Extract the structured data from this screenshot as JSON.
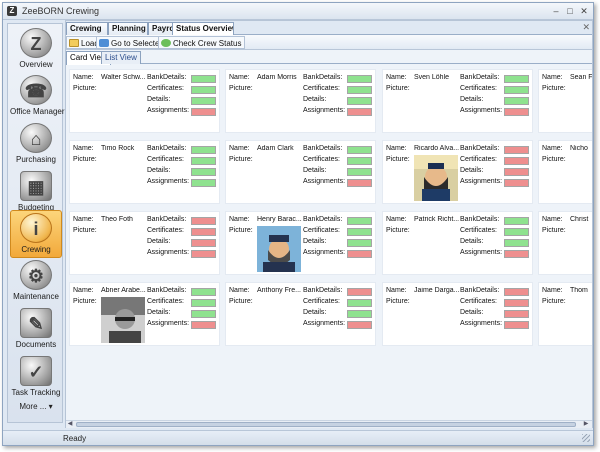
{
  "window": {
    "title": "ZeeBORN Crewing",
    "app_icon": "Z"
  },
  "sidebar": {
    "items": [
      {
        "label": "Overview",
        "icon": "Z",
        "icon_name": "zeeborn-logo-icon"
      },
      {
        "label": "Office Manager",
        "icon": "☎",
        "icon_name": "office-manager-icon"
      },
      {
        "label": "Purchasing",
        "icon": "⌂",
        "icon_name": "purchasing-icon"
      },
      {
        "label": "Budgeting",
        "icon": "▦",
        "icon_name": "budgeting-icon"
      },
      {
        "label": "Crewing",
        "icon": "i",
        "icon_name": "crewing-icon",
        "active": true
      },
      {
        "label": "Maintenance",
        "icon": "⚙",
        "icon_name": "maintenance-icon"
      },
      {
        "label": "Documents",
        "icon": "✎",
        "icon_name": "documents-icon"
      },
      {
        "label": "Task Tracking",
        "icon": "✓",
        "icon_name": "task-tracking-icon"
      }
    ],
    "more_label": "More ... ▾"
  },
  "doc_tabs": [
    {
      "label": "Crewing"
    },
    {
      "label": "Planning"
    },
    {
      "label": "Payro"
    },
    {
      "label": "Status Overview",
      "active": true
    }
  ],
  "toolbar": {
    "load": "Load",
    "goto": "Go to Selected",
    "check": "Check Crew Status"
  },
  "view_tabs": [
    {
      "label": "Card View",
      "active": true
    },
    {
      "label": "List View"
    }
  ],
  "card_labels": {
    "name": "Name:",
    "picture": "Picture:",
    "bank": "BankDetails:",
    "certs": "Certificates:",
    "details": "Details:",
    "assign": "Assignments:"
  },
  "cards": [
    {
      "name": "Walter Schw...",
      "status": [
        "ok",
        "ok",
        "ok",
        "bad"
      ],
      "photo": ""
    },
    {
      "name": "Adam Morris",
      "status": [
        "ok",
        "ok",
        "ok",
        "bad"
      ],
      "photo": ""
    },
    {
      "name": "Sven Löhle",
      "status": [
        "ok",
        "ok",
        "ok",
        "bad"
      ],
      "photo": ""
    },
    {
      "name": "Sean F",
      "status": [],
      "photo": ""
    },
    {
      "name": "Timo Rock",
      "status": [
        "ok",
        "ok",
        "ok",
        "ok"
      ],
      "photo": ""
    },
    {
      "name": "Adam Clark",
      "status": [
        "ok",
        "ok",
        "ok",
        "bad"
      ],
      "photo": ""
    },
    {
      "name": "Ricardo Alva...",
      "status": [
        "bad",
        "bad",
        "bad",
        "bad"
      ],
      "photo": "haddock"
    },
    {
      "name": "Nicho",
      "status": [],
      "photo": ""
    },
    {
      "name": "Theo Foth",
      "status": [
        "bad",
        "bad",
        "bad",
        "bad"
      ],
      "photo": ""
    },
    {
      "name": "Henry Barac...",
      "status": [
        "ok",
        "ok",
        "ok",
        "bad"
      ],
      "photo": "captain"
    },
    {
      "name": "Patrick Richt...",
      "status": [
        "ok",
        "ok",
        "ok",
        "bad"
      ],
      "photo": ""
    },
    {
      "name": "Christ",
      "status": [],
      "photo": ""
    },
    {
      "name": "Abner Arabe...",
      "status": [
        "ok",
        "ok",
        "ok",
        "bad"
      ],
      "photo": "bw"
    },
    {
      "name": "Anthony Fre...",
      "status": [
        "bad",
        "ok",
        "ok",
        "bad"
      ],
      "photo": ""
    },
    {
      "name": "Jaime Darga...",
      "status": [
        "bad",
        "bad",
        "bad",
        "bad"
      ],
      "photo": ""
    },
    {
      "name": "Thom",
      "status": [],
      "photo": ""
    }
  ],
  "status_bar": {
    "text": "Ready"
  }
}
